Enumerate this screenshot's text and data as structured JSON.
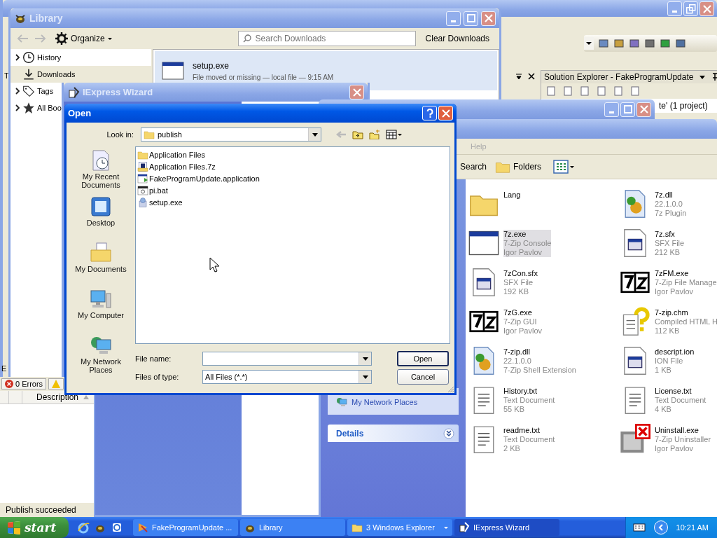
{
  "vs_window": {
    "left_tab": "T",
    "bottom_tab": "E",
    "solution_explorer": {
      "title": "Solution Explorer - FakeProgramUpdate",
      "tree_item": "te' (1 project)"
    },
    "error_list": {
      "errors_tab": "0 Errors",
      "column": "Description"
    },
    "status_bar": "Publish succeeded"
  },
  "library": {
    "title": "Library",
    "organize": "Organize",
    "search": {
      "placeholder": "Search Downloads"
    },
    "clear_button": "Clear Downloads",
    "sidebar": [
      {
        "label": "History",
        "kind": "history",
        "expandable": true,
        "selected": false
      },
      {
        "label": "Downloads",
        "kind": "downloads",
        "expandable": false,
        "selected": true
      },
      {
        "label": "Tags",
        "kind": "tags",
        "expandable": true,
        "selected": false
      },
      {
        "label": "All Boo",
        "kind": "bookmarks",
        "expandable": true,
        "selected": false
      }
    ],
    "downloads": [
      {
        "name": "setup.exe",
        "details": "File moved or missing — local file — 9:15 AM",
        "selected": true
      }
    ]
  },
  "iexpress": {
    "title": "IExpress Wizard"
  },
  "explorer": {
    "menu": [
      "Help"
    ],
    "toolbar": [
      "Search",
      "Folders"
    ],
    "task_links": [
      "My Network Places"
    ],
    "details_header": "Details",
    "files": [
      {
        "kind": "folder",
        "name": "Lang",
        "selected": false
      },
      {
        "kind": "dll",
        "name": "7z.dll",
        "line2": "22.1.0.0",
        "line3": "7z Plugin",
        "selected": false
      },
      {
        "kind": "window",
        "name": "7z.exe",
        "line2": "7-Zip Console",
        "line3": "Igor Pavlov",
        "selected": true
      },
      {
        "kind": "sfx",
        "name": "7z.sfx",
        "line2": "SFX File",
        "line3": "212 KB",
        "selected": false
      },
      {
        "kind": "sfx",
        "name": "7zCon.sfx",
        "line2": "SFX File",
        "line3": "192 KB",
        "selected": false
      },
      {
        "kind": "logo",
        "name": "7zFM.exe",
        "line2": "7-Zip File Manage",
        "line3": "Igor Pavlov",
        "selected": false
      },
      {
        "kind": "logo",
        "name": "7zG.exe",
        "line2": "7-Zip GUI",
        "line3": "Igor Pavlov",
        "selected": false
      },
      {
        "kind": "help",
        "name": "7-zip.chm",
        "line2": "Compiled HTML H",
        "line3": "112 KB",
        "selected": false
      },
      {
        "kind": "dll",
        "name": "7-zip.dll",
        "line2": "22.1.0.0",
        "line3": "7-Zip Shell Extension",
        "selected": false
      },
      {
        "kind": "sfx",
        "name": "descript.ion",
        "line2": "ION File",
        "line3": "1 KB",
        "selected": false
      },
      {
        "kind": "text",
        "name": "History.txt",
        "line2": "Text Document",
        "line3": "55 KB",
        "selected": false
      },
      {
        "kind": "text",
        "name": "License.txt",
        "line2": "Text Document",
        "line3": "4 KB",
        "selected": false
      },
      {
        "kind": "text",
        "name": "readme.txt",
        "line2": "Text Document",
        "line3": "2 KB",
        "selected": false
      },
      {
        "kind": "uninstall",
        "name": "Uninstall.exe",
        "line2": "7-Zip Uninstaller",
        "line3": "Igor Pavlov",
        "selected": false
      }
    ]
  },
  "open_dialog": {
    "title": "Open",
    "look_in_label": "Look in:",
    "look_in": "publish",
    "places": [
      {
        "kind": "recent",
        "label": "My Recent Documents"
      },
      {
        "kind": "desktop",
        "label": "Desktop"
      },
      {
        "kind": "documents",
        "label": "My Documents"
      },
      {
        "kind": "computer",
        "label": "My Computer"
      },
      {
        "kind": "network",
        "label": "My Network Places"
      }
    ],
    "files": [
      {
        "kind": "folder",
        "name": "Application Files",
        "selected": false
      },
      {
        "kind": "archive",
        "name": "Application Files.7z",
        "selected": false
      },
      {
        "kind": "app",
        "name": "FakeProgramUpdate.application",
        "selected": false
      },
      {
        "kind": "batch",
        "name": "pi.bat",
        "selected": false
      },
      {
        "kind": "setup",
        "name": "setup.exe",
        "selected": false
      }
    ],
    "file_name_label": "File name:",
    "files_of_type_label": "Files of type:",
    "files_of_type": "All Files (*.*)",
    "buttons": [
      {
        "label": "Open",
        "default": true
      },
      {
        "label": "Cancel",
        "default": false
      }
    ]
  },
  "taskbar": {
    "start": "start",
    "buttons": [
      {
        "label": "FakeProgramUpdate ...",
        "kind": "vs",
        "selected": false
      },
      {
        "label": "Library",
        "kind": "bug",
        "selected": false
      },
      {
        "label": "3 Windows Explorer",
        "kind": "group",
        "selected": false
      },
      {
        "label": "IExpress Wizard",
        "kind": "wizard",
        "selected": true
      }
    ],
    "clock": "10:21 AM"
  }
}
